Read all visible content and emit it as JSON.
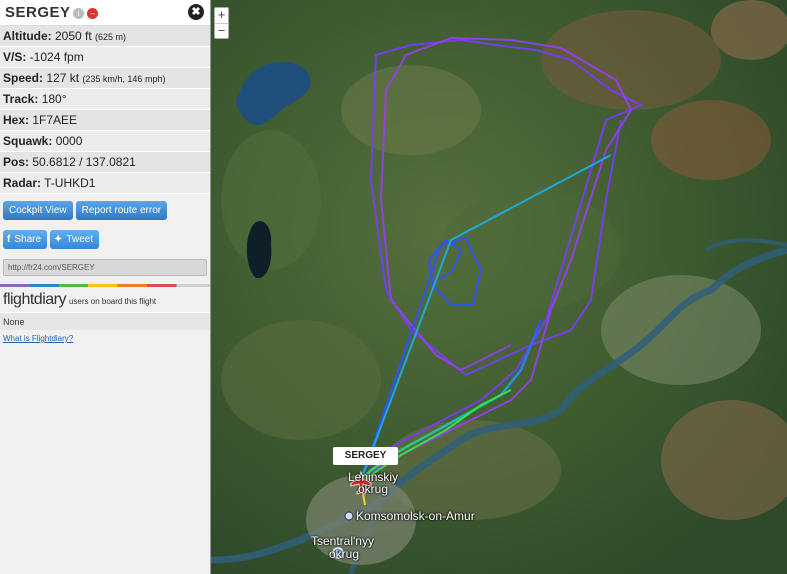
{
  "flight": {
    "callsign": "SERGEY",
    "info_icon": "info-icon",
    "minus_icon": "minus-icon",
    "close_glyph": "✖"
  },
  "details": [
    {
      "label": "Altitude:",
      "value": "2050 ft",
      "extra": "(625 m)"
    },
    {
      "label": "V/S:",
      "value": "-1024 fpm",
      "extra": ""
    },
    {
      "label": "Speed:",
      "value": "127 kt",
      "extra": "(235 km/h, 146 mph)"
    },
    {
      "label": "Track:",
      "value": "180°",
      "extra": ""
    },
    {
      "label": "Hex:",
      "value": "1F7AEE",
      "extra": ""
    },
    {
      "label": "Squawk:",
      "value": "0000",
      "extra": ""
    },
    {
      "label": "Pos:",
      "value": "50.6812 / 137.0821",
      "extra": ""
    },
    {
      "label": "Radar:",
      "value": "T-UHKD1",
      "extra": ""
    }
  ],
  "buttons": {
    "cockpit_view": "Cockpit View",
    "report_route_error": "Report route error",
    "share": "Share",
    "tweet": "Tweet"
  },
  "url": "http://fr24.com/SERGEY",
  "flightdiary": {
    "logo": "flightdiary",
    "caption": "users on board this flight",
    "none": "None",
    "what_link": "What is Flightdiary?"
  },
  "map": {
    "zoom_in": "+",
    "zoom_out": "−",
    "aircraft_label": "SERGEY",
    "places": {
      "leninsky_1": "Leninskiy",
      "leninsky_2": "okrug",
      "komsomolsk": "Komsomolsk-on-Amur",
      "tsentralny_1": "Tsentral'nyy",
      "tsentralny_2": "okrug"
    },
    "colors": {
      "track_purple": "#9b3cff",
      "track_blue": "#2e52ff",
      "track_cyan": "#1ea8d8",
      "track_green": "#35e04a",
      "aircraft": "#e02828"
    }
  }
}
